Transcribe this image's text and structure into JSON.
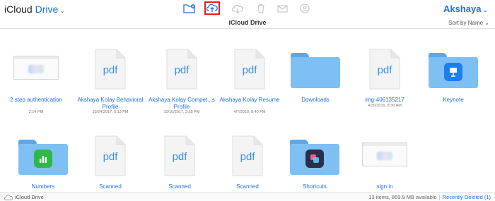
{
  "header": {
    "app_title_part1": "iCloud",
    "app_title_part2": "Drive",
    "user_name": "Akshaya",
    "toolbar_icons": [
      "new-folder-icon",
      "upload-icon",
      "download-icon",
      "trash-icon",
      "mail-icon",
      "share-icon"
    ]
  },
  "subheader": {
    "title": "iCloud Drive",
    "sort_label": "Sort by Name"
  },
  "items": [
    {
      "kind": "screenshot",
      "label": "2 step authentication",
      "date": "2:14 PM"
    },
    {
      "kind": "pdf",
      "thumb_text": "pdf",
      "label": "Akshaya Kolay Behavioral Profile",
      "date": "10/24/2017, 5:13 PM"
    },
    {
      "kind": "pdf",
      "thumb_text": "pdf",
      "label": "Akshaya Kolay Compet...s Profile",
      "date": "10/10/2017, 3:55 PM"
    },
    {
      "kind": "pdf",
      "thumb_text": "pdf",
      "label": "Akshaya Kolay Resume",
      "date": "4/7/2019, 8:40 PM"
    },
    {
      "kind": "folder",
      "label": "Downloads",
      "date": ""
    },
    {
      "kind": "pdf",
      "thumb_text": "pdf",
      "label": "img-406135217",
      "date": "4/30/2019, 8:30 AM"
    },
    {
      "kind": "folder-keynote",
      "label": "Keynote",
      "date": ""
    },
    {
      "kind": "folder-numbers",
      "label": "Numbers",
      "date": ""
    },
    {
      "kind": "pdf",
      "thumb_text": "pdf",
      "label": "Scanned",
      "date": ""
    },
    {
      "kind": "pdf",
      "thumb_text": "pdf",
      "label": "Scanned",
      "date": ""
    },
    {
      "kind": "pdf",
      "thumb_text": "pdf",
      "label": "Scanned",
      "date": ""
    },
    {
      "kind": "folder-shortcuts",
      "label": "Shortcuts",
      "date": ""
    },
    {
      "kind": "screenshot",
      "label": "sign in",
      "date": ""
    }
  ],
  "footer": {
    "location": "iCloud Drive",
    "summary": "13 items, 869.9 MB available",
    "recently_deleted": "Recently Deleted (1)"
  },
  "colors": {
    "accent": "#1a73e8",
    "folder": "#7fc0f4",
    "upload_highlight": "#e02020",
    "keynote": "#1c7ff0",
    "numbers": "#2fb84a"
  }
}
